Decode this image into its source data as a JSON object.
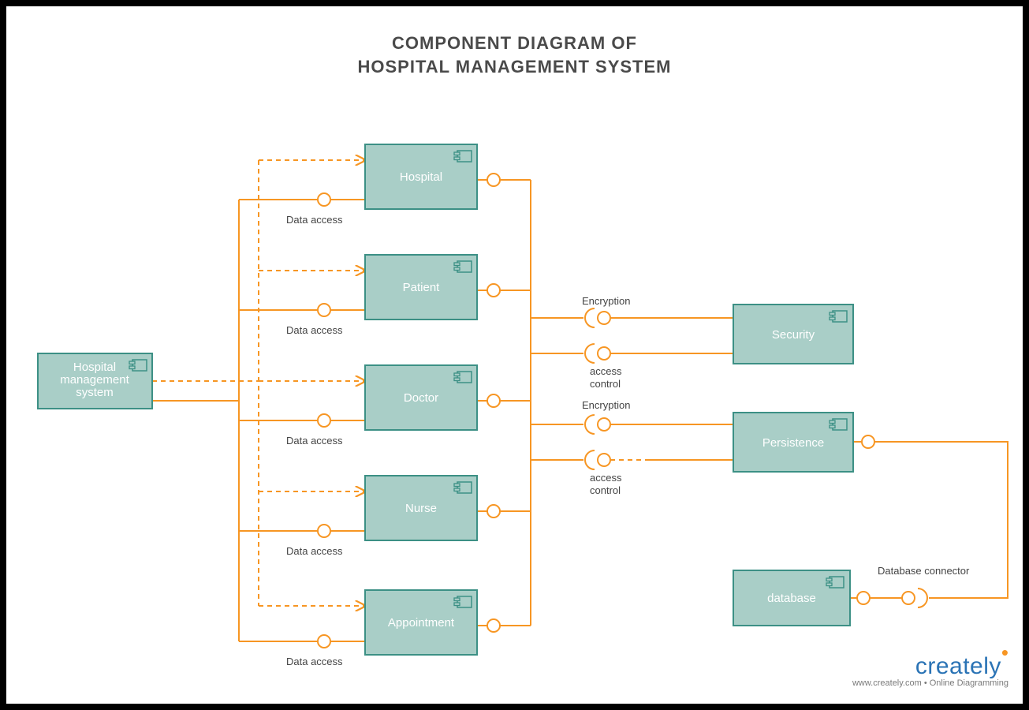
{
  "title_line1": "COMPONENT DIAGRAM OF",
  "title_line2": "HOSPITAL MANAGEMENT SYSTEM",
  "components": {
    "root": "Hospital\nmanagement\nsystem",
    "hospital": "Hospital",
    "patient": "Patient",
    "doctor": "Doctor",
    "nurse": "Nurse",
    "appointment": "Appointment",
    "security": "Security",
    "persistence": "Persistence",
    "database": "database"
  },
  "labels": {
    "data_access": "Data access",
    "encryption": "Encryption",
    "access_control_1": "access",
    "access_control_2": "control",
    "db_connector": "Database connector"
  },
  "footer": {
    "brand": "creately",
    "sub": "www.creately.com • Online Diagramming"
  },
  "colors": {
    "component_fill": "#a9cec7",
    "component_stroke": "#3c9085",
    "connector": "#f79623"
  }
}
